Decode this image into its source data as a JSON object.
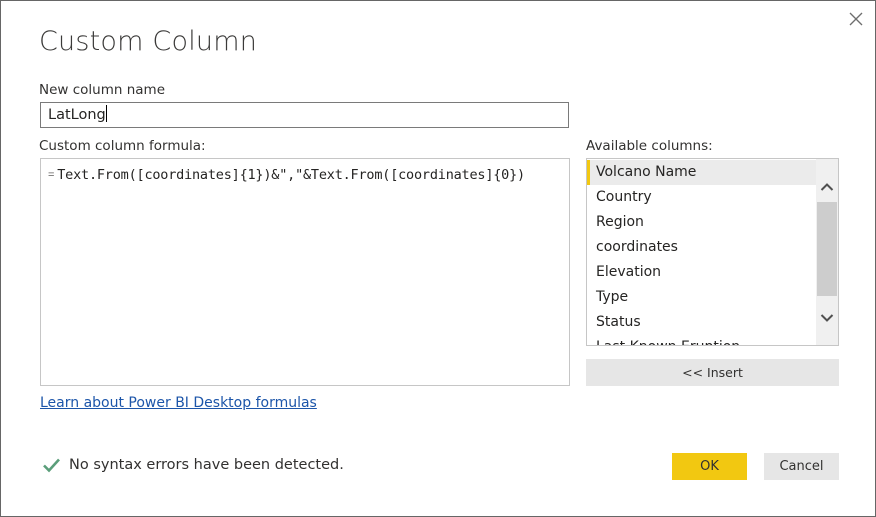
{
  "dialog": {
    "title": "Custom Column",
    "close_icon": "close-x-icon"
  },
  "new_column": {
    "label": "New column name",
    "value": "LatLong"
  },
  "formula": {
    "label": "Custom column formula:",
    "prefix": "=",
    "value": "Text.From([coordinates]{1})&\",\"&Text.From([coordinates]{0})"
  },
  "available_columns": {
    "label": "Available columns:",
    "items": [
      {
        "label": "Volcano Name",
        "selected": true
      },
      {
        "label": "Country",
        "selected": false
      },
      {
        "label": "Region",
        "selected": false
      },
      {
        "label": "coordinates",
        "selected": false
      },
      {
        "label": "Elevation",
        "selected": false
      },
      {
        "label": "Type",
        "selected": false
      },
      {
        "label": "Status",
        "selected": false
      },
      {
        "label": "Last Known Eruption",
        "selected": false
      }
    ],
    "insert_label": "<< Insert"
  },
  "learn_link": "Learn about Power BI Desktop formulas",
  "status": {
    "icon": "checkmark-icon",
    "text": "No syntax errors have been detected."
  },
  "buttons": {
    "ok": "OK",
    "cancel": "Cancel"
  },
  "colors": {
    "accent": "#f2c811",
    "success": "#5a9e7a",
    "link": "#1c55a9"
  }
}
